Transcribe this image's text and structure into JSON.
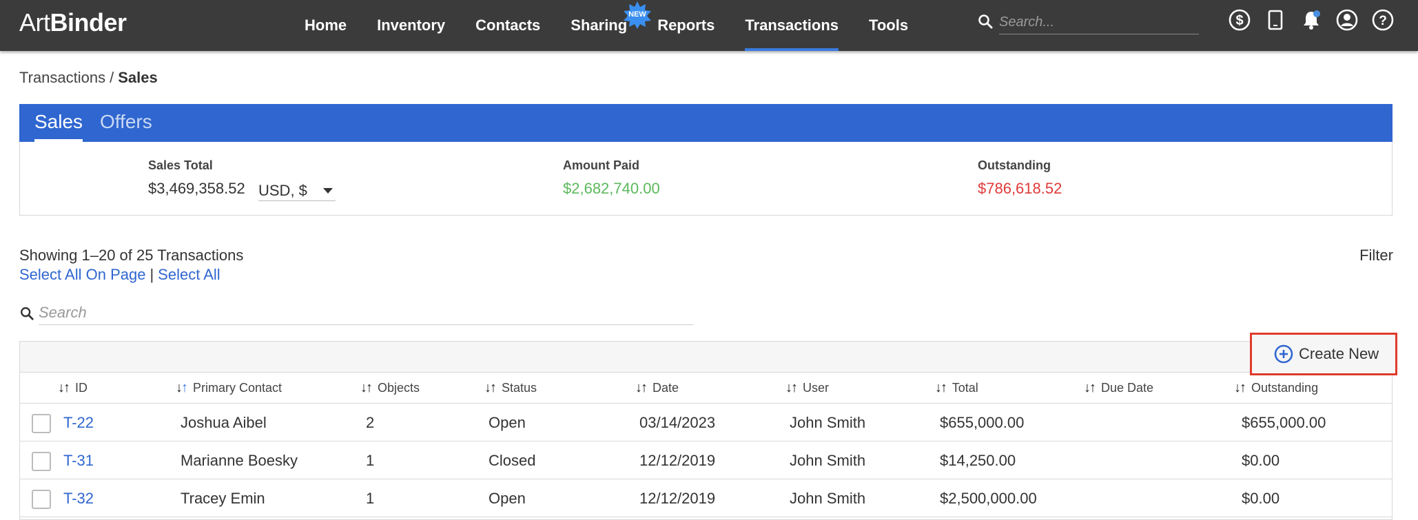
{
  "app": {
    "logo_art": "Art",
    "logo_binder": "Binder"
  },
  "nav": {
    "items": [
      {
        "label": "Home"
      },
      {
        "label": "Inventory"
      },
      {
        "label": "Contacts"
      },
      {
        "label": "Sharing"
      },
      {
        "label": "Reports"
      },
      {
        "label": "Transactions"
      },
      {
        "label": "Tools"
      }
    ],
    "active": "Transactions",
    "new_badge": "NEW",
    "search_placeholder": "Search..."
  },
  "toolbar_icons": [
    "dollar-circle-icon",
    "tablet-icon",
    "bell-icon",
    "account-icon",
    "help-icon"
  ],
  "breadcrumb": {
    "parent": "Transactions",
    "separator": "/",
    "current": "Sales"
  },
  "tabs": {
    "sales": "Sales",
    "offers": "Offers",
    "active": "Sales"
  },
  "summary": {
    "sales_total_label": "Sales Total",
    "sales_total_value": "$3,469,358.52",
    "currency": "USD, $",
    "amount_paid_label": "Amount Paid",
    "amount_paid_value": "$2,682,740.00",
    "outstanding_label": "Outstanding",
    "outstanding_value": "$786,618.52"
  },
  "listing": {
    "showing": "Showing 1–20 of 25 Transactions",
    "select_all_on_page": "Select All On Page",
    "divider": "|",
    "select_all": "Select All",
    "filter": "Filter",
    "search_placeholder": "Search",
    "create_new": "Create New"
  },
  "table": {
    "columns": [
      "ID",
      "Primary Contact",
      "Objects",
      "Status",
      "Date",
      "User",
      "Total",
      "Due Date",
      "Outstanding"
    ],
    "rows": [
      {
        "id": "T-22",
        "contact": "Joshua Aibel",
        "objects": "2",
        "status": "Open",
        "date": "03/14/2023",
        "user": "John Smith",
        "total": "$655,000.00",
        "due": "",
        "outstanding": "$655,000.00"
      },
      {
        "id": "T-31",
        "contact": "Marianne Boesky",
        "objects": "1",
        "status": "Closed",
        "date": "12/12/2019",
        "user": "John Smith",
        "total": "$14,250.00",
        "due": "",
        "outstanding": "$0.00"
      },
      {
        "id": "T-32",
        "contact": "Tracey Emin",
        "objects": "1",
        "status": "Open",
        "date": "12/12/2019",
        "user": "John Smith",
        "total": "$2,500,000.00",
        "due": "",
        "outstanding": "$0.00"
      }
    ]
  }
}
